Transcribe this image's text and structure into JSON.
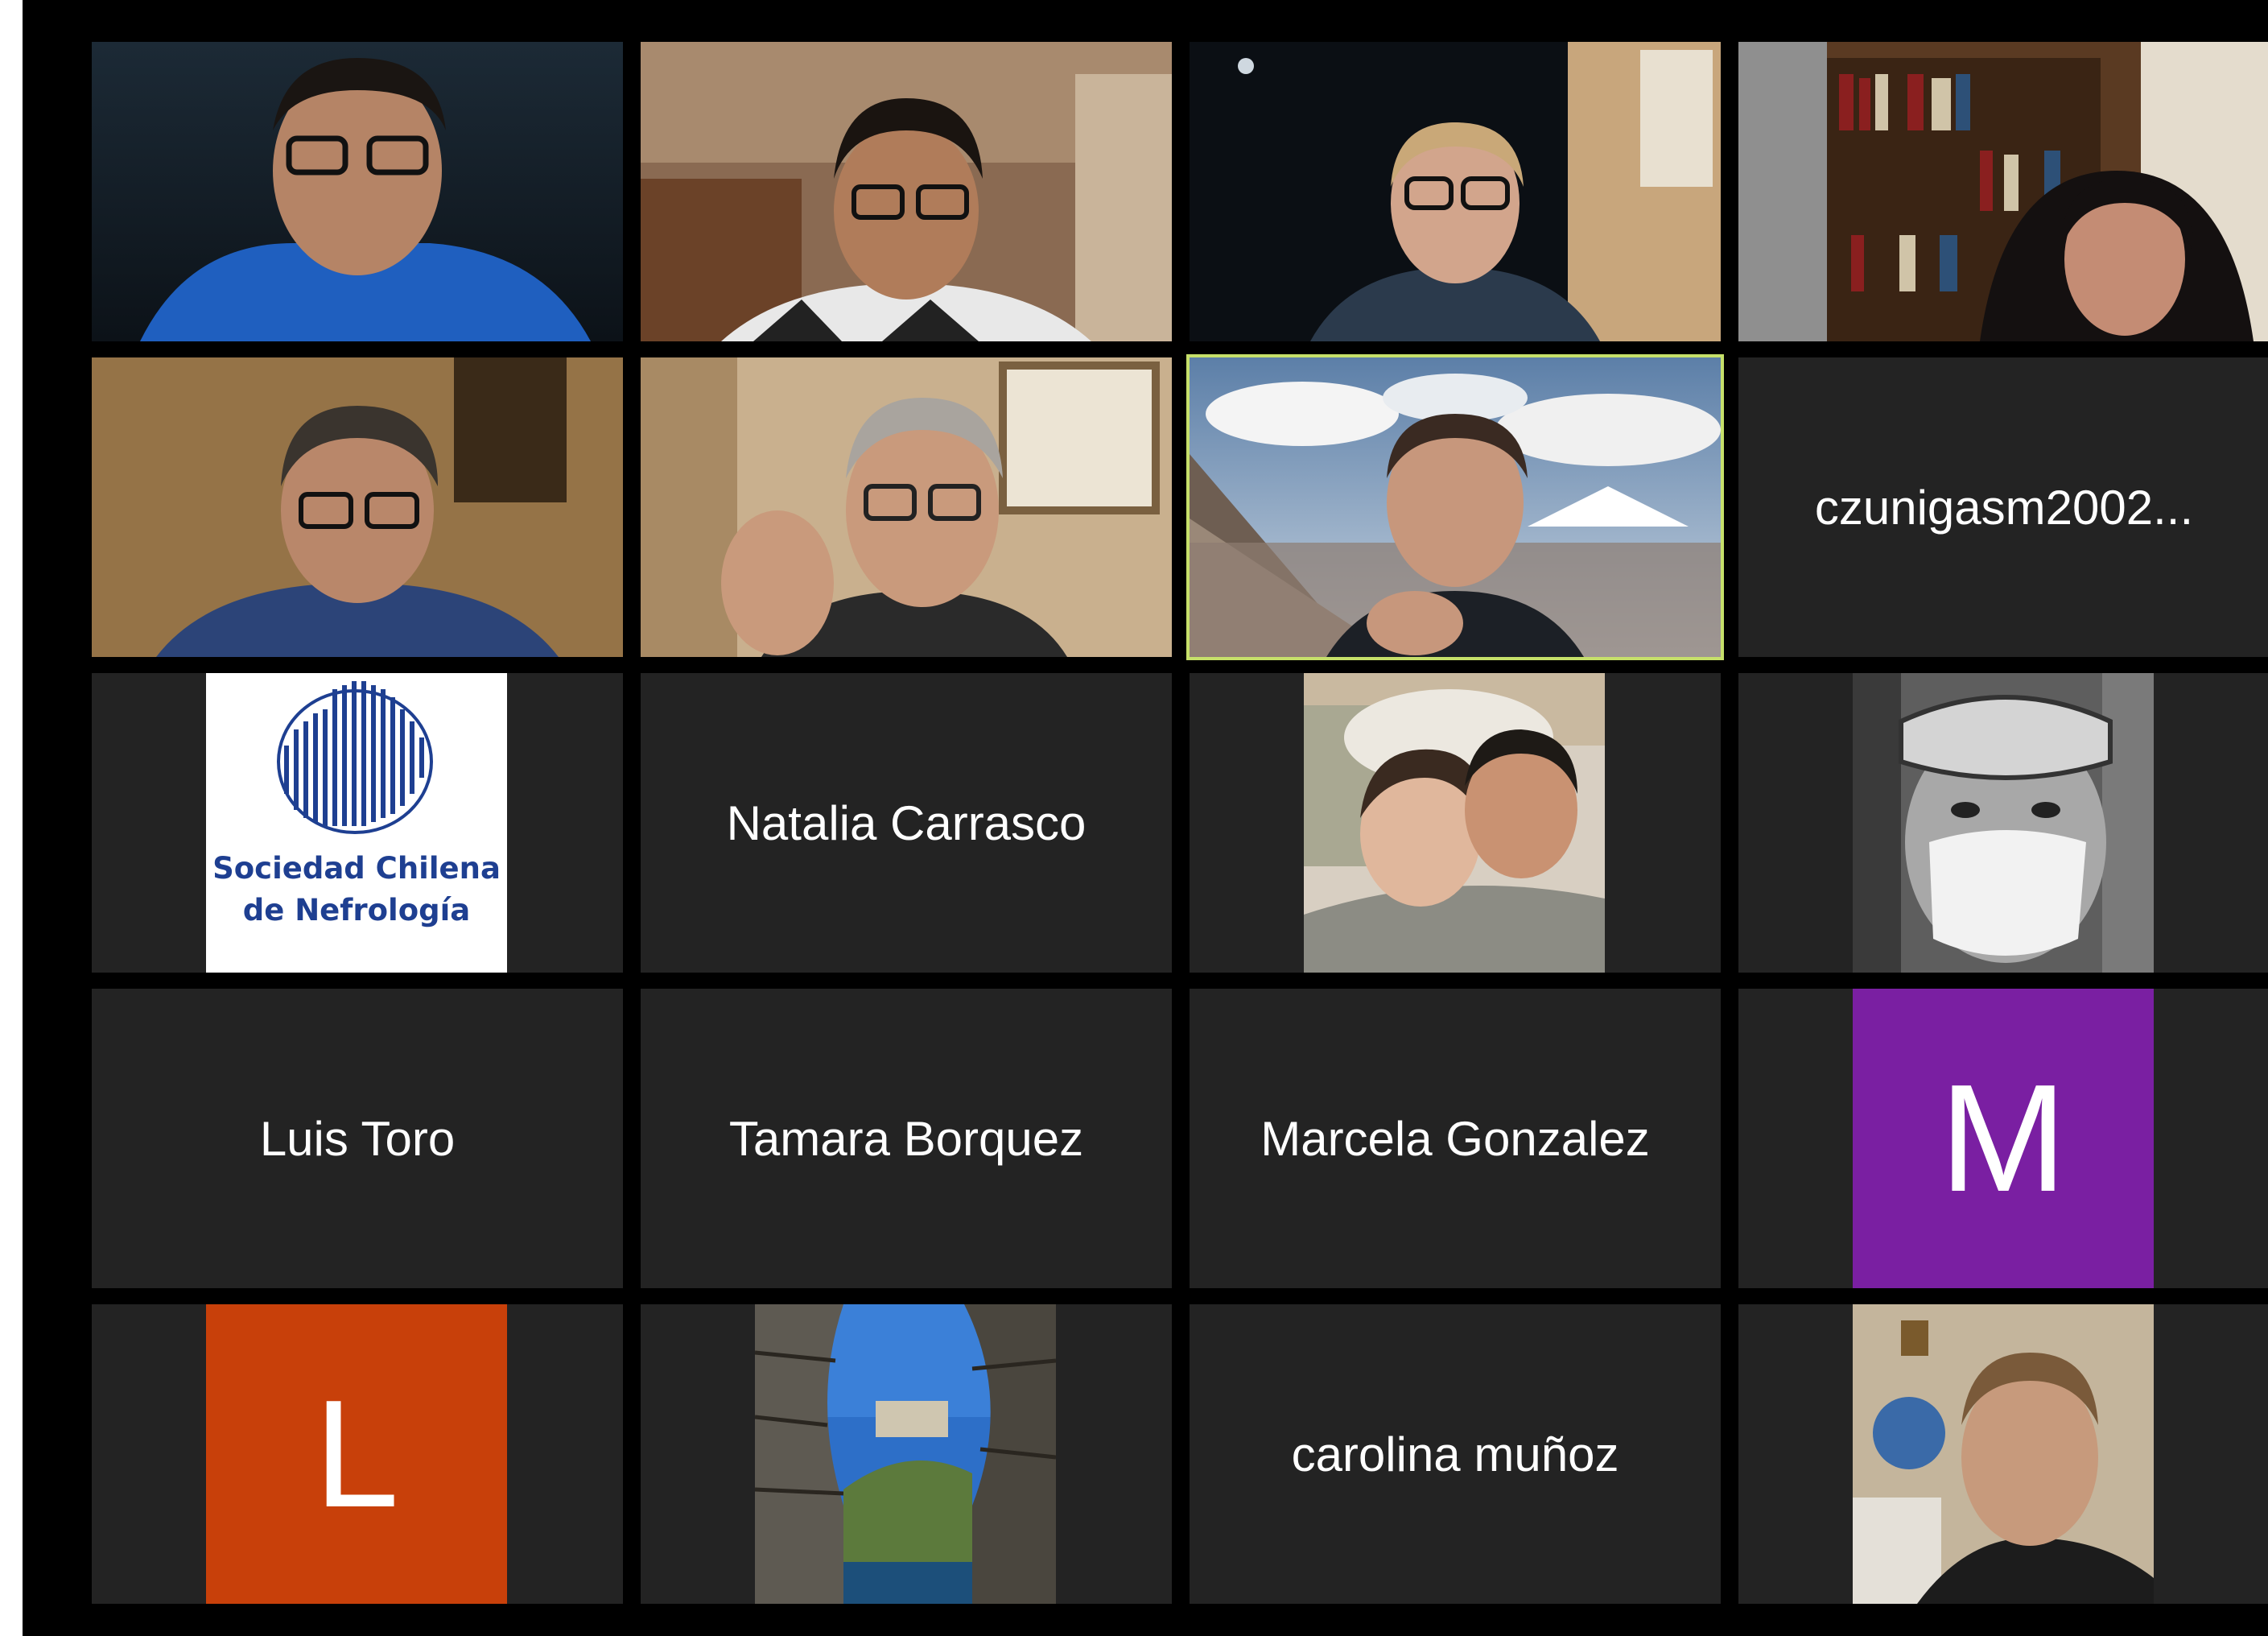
{
  "participants": [
    {
      "kind": "video"
    },
    {
      "kind": "video"
    },
    {
      "kind": "video"
    },
    {
      "kind": "video"
    },
    {
      "kind": "video"
    },
    {
      "kind": "video"
    },
    {
      "kind": "video",
      "active_speaker": true
    },
    {
      "kind": "name",
      "display_name": "czunigasm2002..."
    },
    {
      "kind": "logo",
      "logo_line1": "Sociedad Chilena",
      "logo_line2": "de Nefrología"
    },
    {
      "kind": "name",
      "display_name": "Natalia Carrasco"
    },
    {
      "kind": "photo"
    },
    {
      "kind": "photo"
    },
    {
      "kind": "name",
      "display_name": "Luis Toro"
    },
    {
      "kind": "name",
      "display_name": "Tamara Borquez"
    },
    {
      "kind": "name",
      "display_name": "Marcela Gonzalez"
    },
    {
      "kind": "initial",
      "initial": "M",
      "color": "#7a1fa2"
    },
    {
      "kind": "initial",
      "initial": "L",
      "color": "#c8400a"
    },
    {
      "kind": "photo"
    },
    {
      "kind": "name",
      "display_name": "carolina muñoz"
    },
    {
      "kind": "photo"
    }
  ],
  "colors": {
    "active_border": "#c6e06a",
    "tile_background": "#232323",
    "window_background": "#000000"
  }
}
